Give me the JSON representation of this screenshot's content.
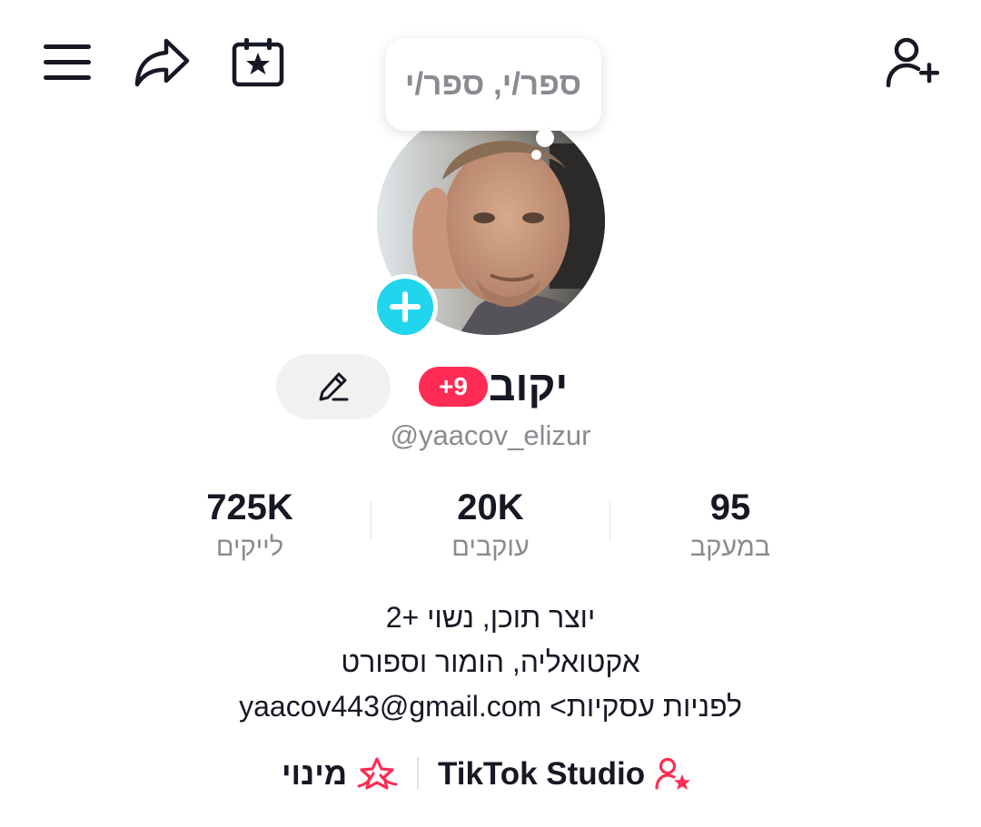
{
  "top_bar": {
    "icons": [
      "menu-icon",
      "share-icon",
      "calendar-star-icon",
      "add-friend-icon"
    ]
  },
  "profile": {
    "note": "ספר/י, ספר/י",
    "display_name": "יקוב",
    "age_badge": "+9",
    "username": "@yaacov_elizur",
    "avatar_icon": "add-story-icon"
  },
  "stats": [
    {
      "value": "95",
      "label": "במעקב"
    },
    {
      "value": "20K",
      "label": "עוקבים"
    },
    {
      "value": "725K",
      "label": "לייקים"
    }
  ],
  "bio": {
    "lines": [
      "יוצר תוכן, נשוי +2",
      "אקטואליה, הומור וספורט",
      "לפניות עסקיות> yaacov443@gmail.com"
    ]
  },
  "links": {
    "studio_label": "TikTok Studio",
    "promote_label": "מינוי"
  },
  "colors": {
    "accent_red": "#fe2c55",
    "story_blue": "#20d5ec",
    "muted_text": "#8a8b91"
  }
}
